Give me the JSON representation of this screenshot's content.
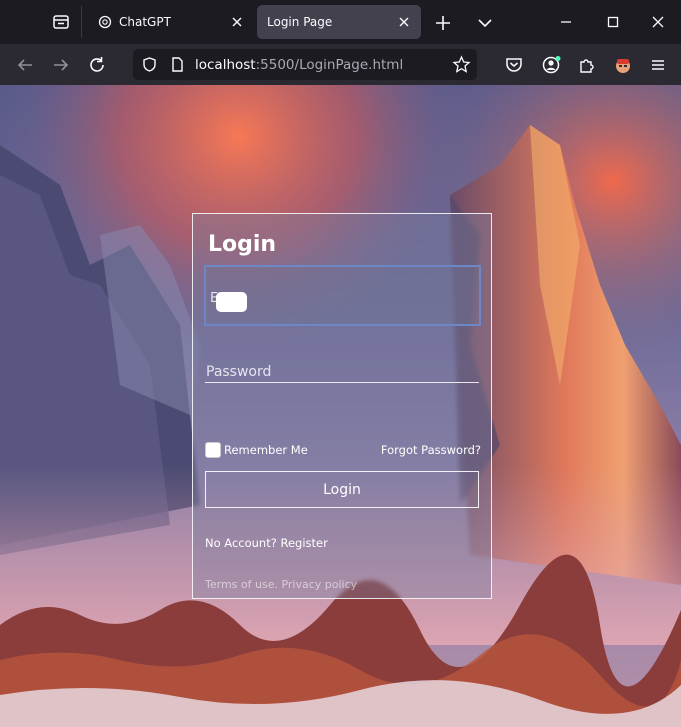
{
  "browser": {
    "tabs": [
      {
        "title": "ChatGPT",
        "active": false
      },
      {
        "title": "Login Page",
        "active": true
      }
    ],
    "url_host": "localhost",
    "url_rest": ":5500/LoginPage.html"
  },
  "login": {
    "title": "Login",
    "email_label": "E",
    "password_placeholder": "Password",
    "remember_label": "Remember Me",
    "forgot_label": "Forgot Password?",
    "login_button": "Login",
    "no_account_text": "No Account?",
    "register_link": "Register",
    "terms_link": "Terms of use.",
    "privacy_link": "Privacy policy"
  },
  "colors": {
    "chrome_dark": "#1c1b22",
    "chrome_nav": "#2b2a33",
    "active_tab": "#42414d",
    "focus_border": "#6d86c5"
  }
}
